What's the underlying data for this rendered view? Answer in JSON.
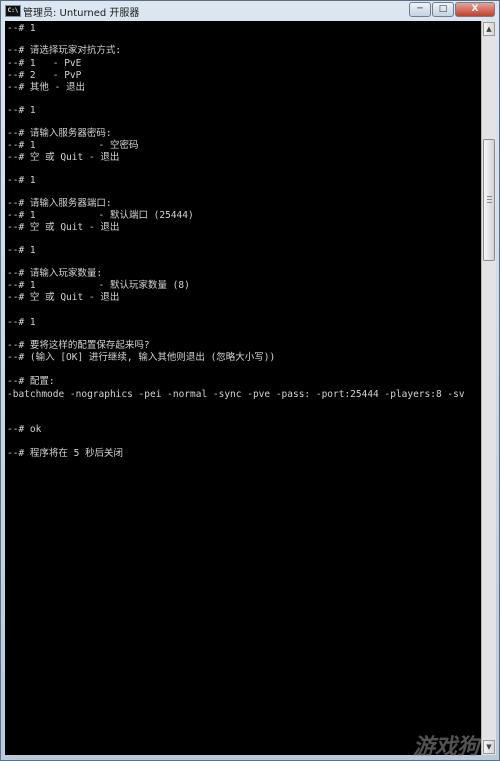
{
  "window": {
    "icon_text": "C:\\",
    "title": "管理员:  Unturned 开服器",
    "controls": {
      "minimize": "─",
      "maximize": "□",
      "close": "X"
    }
  },
  "console": {
    "lines": [
      "--# 1",
      "",
      "--# 请选择玩家对抗方式:",
      "--# 1   - PvE",
      "--# 2   - PvP",
      "--# 其他 - 退出",
      "",
      "--# 1",
      "",
      "--# 请输入服务器密码:",
      "--# 1           - 空密码",
      "--# 空 或 Quit - 退出",
      "",
      "--# 1",
      "",
      "--# 请输入服务器端口:",
      "--# 1           - 默认端口 (25444)",
      "--# 空 或 Quit - 退出",
      "",
      "--# 1",
      "",
      "--# 请输入玩家数量:",
      "--# 1           - 默认玩家数量 (8)",
      "--# 空 或 Quit - 退出",
      "",
      "--# 1",
      "",
      "--# 要将这样的配置保存起来吗?",
      "--# (输入 [OK] 进行继续, 输入其他则退出 (忽略大小写))",
      "",
      "--# 配置:",
      "-batchmode -nographics -pei -normal -sync -pve -pass: -port:25444 -players:8 -sv",
      "",
      "",
      "",
      "--# ok",
      "",
      "",
      "--# 程序将在 5 秒后关闭"
    ]
  },
  "scrollbar": {
    "up_arrow": "▲",
    "down_arrow": "▼"
  },
  "watermark": "游戏狗"
}
